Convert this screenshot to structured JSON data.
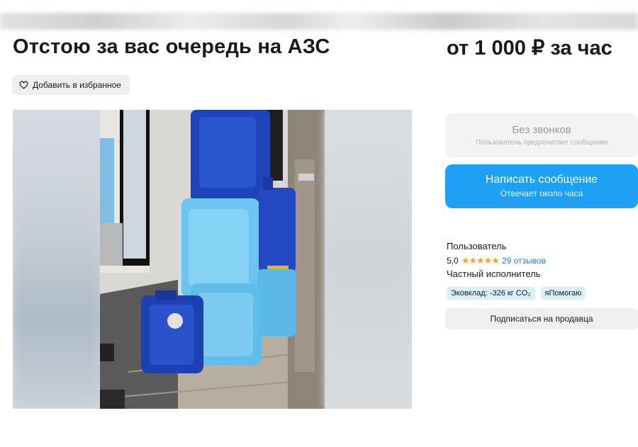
{
  "header": {
    "title": "Отстою за вас очередь на АЗС",
    "price": "от 1 000 ₽ за час"
  },
  "favorite": {
    "label": "Добавить в избранное",
    "icon": "heart-icon"
  },
  "contact": {
    "no_calls_title": "Без звонков",
    "no_calls_sub": "Пользователь предпочитает сообщения",
    "message_title": "Написать сообщение",
    "message_sub": "Отвечает около часа"
  },
  "seller": {
    "name": "Пользователь",
    "rating": "5,0",
    "stars": "★★★★★",
    "reviews": "29 отзывов",
    "type": "Частный исполнитель",
    "badges": [
      "Эковклад: -326 кг CO₂",
      "яПомогаю"
    ],
    "subscribe": "Подписаться на продавца"
  },
  "colors": {
    "accent_blue": "#1ea1f5",
    "star": "#f5a623",
    "link": "#1e7fd6"
  }
}
